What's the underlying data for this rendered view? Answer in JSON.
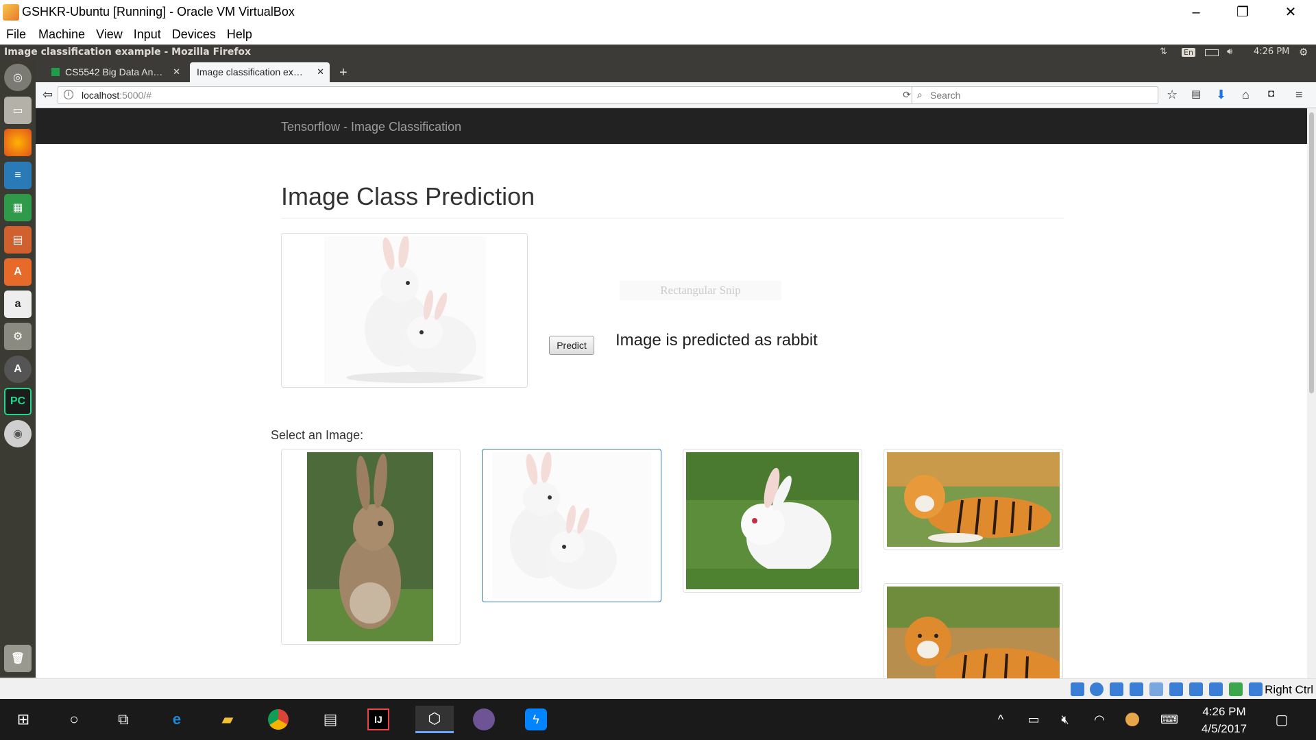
{
  "vbox": {
    "title": "GSHKR-Ubuntu [Running] - Oracle VM VirtualBox",
    "menu": [
      "File",
      "Machine",
      "View",
      "Input",
      "Devices",
      "Help"
    ],
    "minimize": "–",
    "restore": "❐",
    "close": "✕",
    "host_key": "Right Ctrl"
  },
  "ubuntu_panel": {
    "window_title": "Image classification example - Mozilla Firefox",
    "keyboard": "En",
    "time": "4:26 PM"
  },
  "launcher": {
    "apps": [
      "ubuntu-dash",
      "files",
      "firefox",
      "writer",
      "calc",
      "impress",
      "software-center",
      "amazon",
      "system-settings",
      "software-updater",
      "pycharm",
      "dvd",
      "trash"
    ]
  },
  "firefox": {
    "tabs": [
      {
        "label": "CS5542 Big Data An…",
        "active": false
      },
      {
        "label": "Image classification ex…",
        "active": true
      }
    ],
    "new_tab": "+",
    "url_host": "localhost",
    "url_rest": ":5000/#",
    "search_placeholder": "Search"
  },
  "page": {
    "brand": "Tensorflow - Image Classification",
    "heading": "Image Class Prediction",
    "predict_button": "Predict",
    "result": "Image is predicted as rabbit",
    "snip_ghost": "Rectangular Snip",
    "select_label": "Select an Image:",
    "gallery": [
      {
        "subject": "brown rabbit",
        "selected": false
      },
      {
        "subject": "two white rabbits",
        "selected": true
      },
      {
        "subject": "white rabbit on grass",
        "selected": false
      },
      {
        "subject": "tiger lying down",
        "selected": false
      },
      {
        "subject": "tiger lying in grass",
        "selected": false
      }
    ]
  },
  "taskbar": {
    "time": "4:26 PM",
    "date": "4/5/2017"
  }
}
